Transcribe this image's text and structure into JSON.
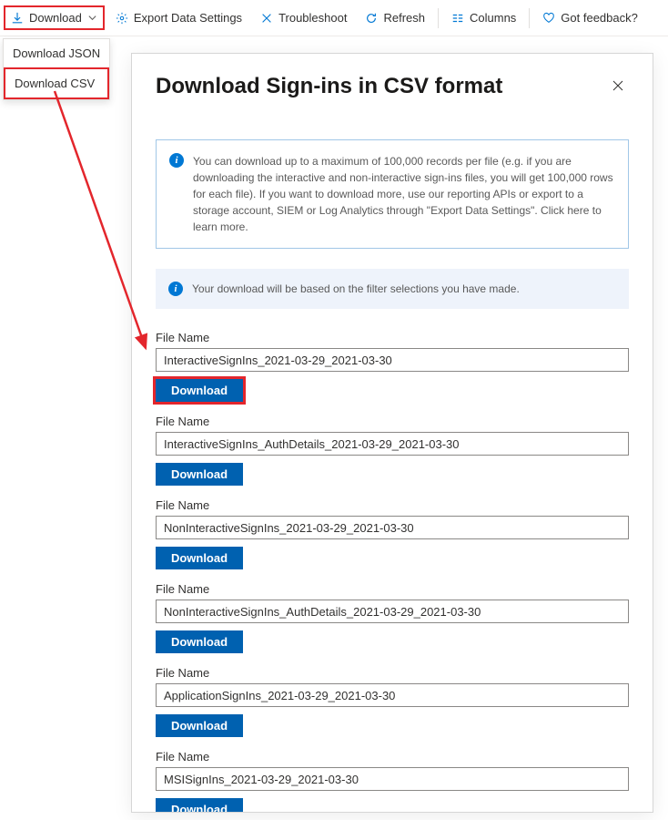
{
  "toolbar": {
    "download": "Download",
    "export": "Export Data Settings",
    "troubleshoot": "Troubleshoot",
    "refresh": "Refresh",
    "columns": "Columns",
    "feedback": "Got feedback?"
  },
  "dropdown": {
    "json": "Download JSON",
    "csv": "Download CSV"
  },
  "panel": {
    "title": "Download Sign-ins in CSV format",
    "info1": "You can download up to a maximum of 100,000 records per file (e.g. if you are downloading the interactive and non-interactive sign-ins files, you will get 100,000 rows for each file).  If you want to download more, use our reporting APIs or export to a storage account, SIEM or Log Analytics through \"Export Data Settings\". Click here to learn more.",
    "info2": "Your download will be based on the filter selections you have made.",
    "file_label": "File Name",
    "download_btn": "Download",
    "files": {
      "f0": "InteractiveSignIns_2021-03-29_2021-03-30",
      "f1": "InteractiveSignIns_AuthDetails_2021-03-29_2021-03-30",
      "f2": "NonInteractiveSignIns_2021-03-29_2021-03-30",
      "f3": "NonInteractiveSignIns_AuthDetails_2021-03-29_2021-03-30",
      "f4": "ApplicationSignIns_2021-03-29_2021-03-30",
      "f5": "MSISignIns_2021-03-29_2021-03-30"
    }
  }
}
